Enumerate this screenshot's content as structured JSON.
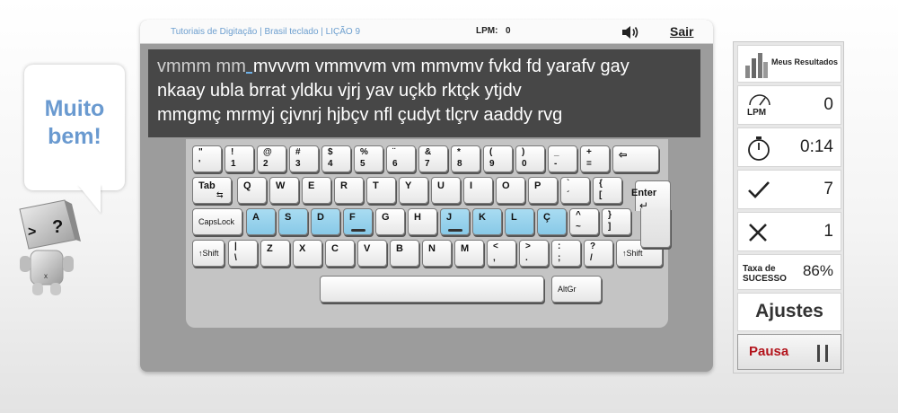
{
  "feedback": {
    "message_line1": "Muito",
    "message_line2": "bem!"
  },
  "mascot": {
    "face_left": ">",
    "face_right": "?",
    "body_mark": "x"
  },
  "header": {
    "breadcrumb": "Tutoriais de Digitação | Brasil teclado | LIÇÃO 9",
    "lpm_label": "LPM:",
    "lpm_value": "0",
    "sound_icon": "speaker-icon",
    "exit_label": "Sair"
  },
  "exercise": {
    "typed": "vmmm mm",
    "remaining_line1": "mvvvm vmmvvm vm mmvmv fvkd fd yarafv gay",
    "line2": "nkaay ubla brrat yldku vjrj yav uçkb rktçk ytjdv",
    "line3": "mmgmç mrmyj çjvnrj hjbçv nfl çudyt tlçrv aaddy rvg"
  },
  "keyboard": {
    "row1": [
      {
        "shift": "\"",
        "base": "'"
      },
      {
        "shift": "!",
        "base": "1"
      },
      {
        "shift": "@",
        "base": "2"
      },
      {
        "shift": "#",
        "base": "3"
      },
      {
        "shift": "$",
        "base": "4"
      },
      {
        "shift": "%",
        "base": "5"
      },
      {
        "shift": "¨",
        "base": "6"
      },
      {
        "shift": "&",
        "base": "7"
      },
      {
        "shift": "*",
        "base": "8"
      },
      {
        "shift": "(",
        "base": "9"
      },
      {
        "shift": ")",
        "base": "0"
      },
      {
        "shift": "_",
        "base": "-"
      },
      {
        "shift": "+",
        "base": "="
      }
    ],
    "backspace": "⇦",
    "tab": "Tab",
    "tab_glyph": "⇆",
    "row2": [
      {
        "letter": "Q"
      },
      {
        "letter": "W"
      },
      {
        "letter": "E"
      },
      {
        "letter": "R"
      },
      {
        "letter": "T"
      },
      {
        "letter": "Y"
      },
      {
        "letter": "U"
      },
      {
        "letter": "I"
      },
      {
        "letter": "O"
      },
      {
        "letter": "P"
      },
      {
        "shift": "`",
        "base": "´"
      },
      {
        "shift": "{",
        "base": "["
      }
    ],
    "enter": "Enter",
    "enter_glyph": "↵",
    "capslock": "CapsLock",
    "row3": [
      {
        "letter": "A",
        "home": true
      },
      {
        "letter": "S",
        "home": true
      },
      {
        "letter": "D",
        "home": true
      },
      {
        "letter": "F",
        "home": true,
        "bump": true
      },
      {
        "letter": "G"
      },
      {
        "letter": "H"
      },
      {
        "letter": "J",
        "home": true,
        "bump": true
      },
      {
        "letter": "K",
        "home": true
      },
      {
        "letter": "L",
        "home": true
      },
      {
        "letter": "Ç",
        "home": true
      },
      {
        "shift": "^",
        "base": "~"
      },
      {
        "shift": "}",
        "base": "]"
      }
    ],
    "lshift": "↑Shift",
    "row4": [
      {
        "shift": "|",
        "base": "\\"
      },
      {
        "letter": "Z"
      },
      {
        "letter": "X"
      },
      {
        "letter": "C"
      },
      {
        "letter": "V"
      },
      {
        "letter": "B"
      },
      {
        "letter": "N"
      },
      {
        "letter": "M"
      },
      {
        "shift": "<",
        "base": ","
      },
      {
        "shift": ">",
        "base": "."
      },
      {
        "shift": ":",
        "base": ";"
      },
      {
        "shift": "?",
        "base": "/"
      }
    ],
    "rshift": "↑Shift",
    "altgr": "AltGr"
  },
  "stats": {
    "results_label": "Meus Resultados",
    "lpm_label": "LPM",
    "lpm_value": "0",
    "time_value": "0:14",
    "correct_value": "7",
    "errors_value": "1",
    "success_label_line1": "Taxa de",
    "success_label_line2": "SUCESSO",
    "success_value": "86%",
    "settings_label": "Ajustes",
    "pause_label": "Pausa",
    "icons": {
      "results": "bar-chart-icon",
      "lpm": "speedometer-icon",
      "time": "stopwatch-icon",
      "correct": "checkmark-icon",
      "errors": "cross-icon",
      "pause": "pause-icon"
    }
  },
  "colors": {
    "home_key": "#88c9e7",
    "accent_blue": "#6a9ad0",
    "pause_red": "#b3141c",
    "textbox_bg": "#474747",
    "panel_gray": "#9c9c9c"
  }
}
